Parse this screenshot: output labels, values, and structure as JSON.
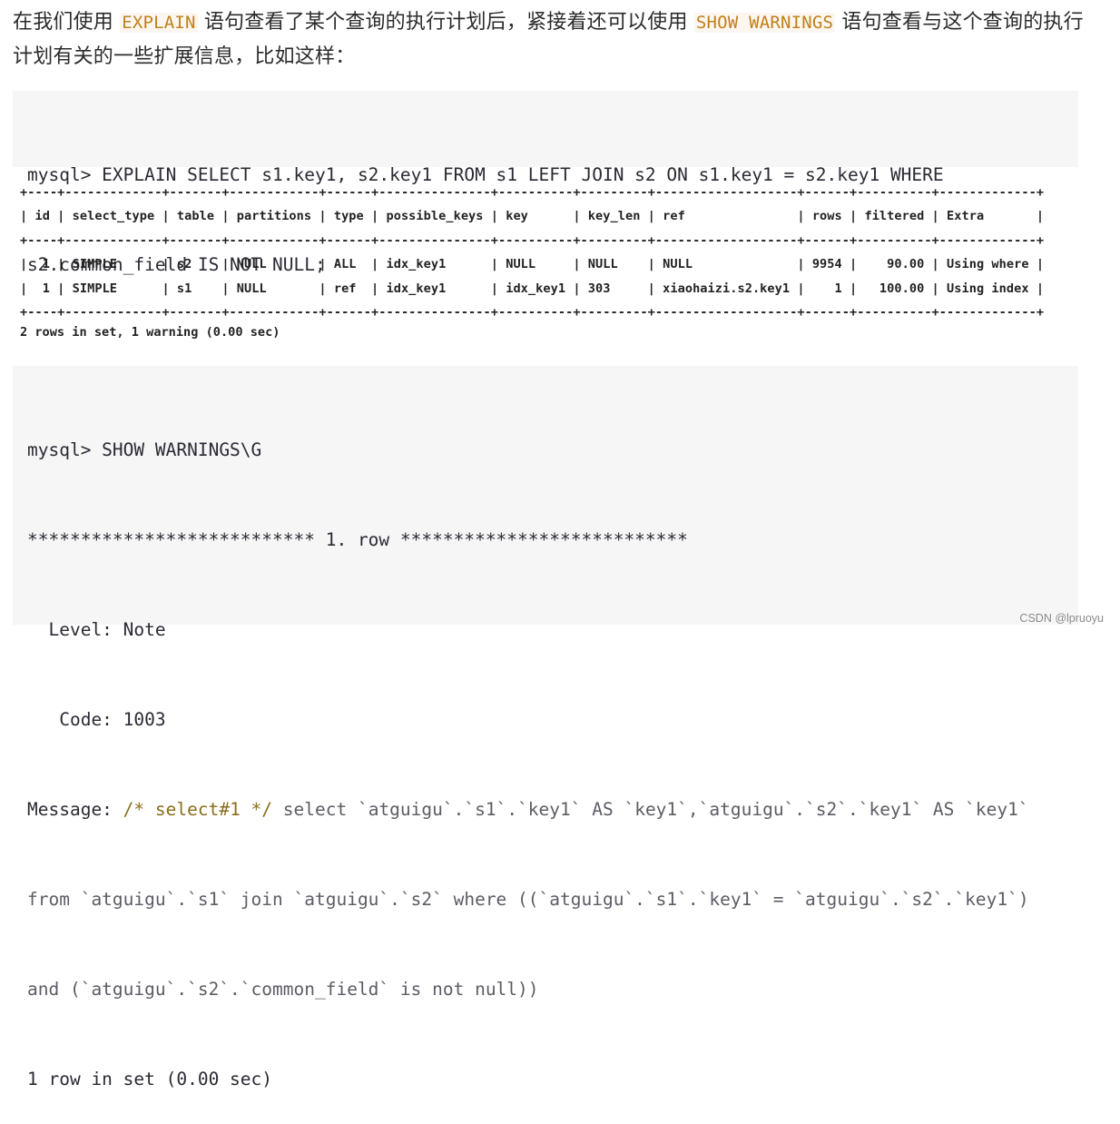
{
  "paragraph": {
    "segments": [
      {
        "type": "text",
        "value": "在我们使用 "
      },
      {
        "type": "code",
        "value": "EXPLAIN"
      },
      {
        "type": "text",
        "value": " 语句查看了某个查询的执行计划后，紧接着还可以使用 "
      },
      {
        "type": "code",
        "value": "SHOW WARNINGS"
      },
      {
        "type": "text",
        "value": " 语句查看与这个查询的执行计划有关的一些扩展信息，比如这样："
      }
    ]
  },
  "code_block_1": {
    "lines": [
      "mysql> EXPLAIN SELECT s1.key1, s2.key1 FROM s1 LEFT JOIN s2 ON s1.key1 = s2.key1 WHERE",
      "s2.common_field IS NOT NULL;"
    ]
  },
  "explain_table": {
    "border": "+----+-------------+-------+------------+------+---------------+----------+---------+-------------------+------+----------+-------------+",
    "columns": [
      "id",
      "select_type",
      "table",
      "partitions",
      "type",
      "possible_keys",
      "key",
      "key_len",
      "ref",
      "rows",
      "filtered",
      "Extra"
    ],
    "rows": [
      [
        "1",
        "SIMPLE",
        "s2",
        "NULL",
        "ALL",
        "idx_key1",
        "NULL",
        "NULL",
        "NULL",
        "9954",
        "90.00",
        "Using where"
      ],
      [
        "1",
        "SIMPLE",
        "s1",
        "NULL",
        "ref",
        "idx_key1",
        "idx_key1",
        "303",
        "xiaohaizi.s2.key1",
        "1",
        "100.00",
        "Using index"
      ]
    ],
    "summary": "2 rows in set, 1 warning (0.00 sec)"
  },
  "code_block_2": {
    "command": "mysql> SHOW WARNINGS\\G",
    "row_header": "*************************** 1. row ***************************",
    "level_label": "  Level:",
    "level_value": " Note",
    "code_label": "   Code:",
    "code_value": " 1003",
    "message_label": "Message: ",
    "message_comment": "/* select#1 */",
    "message_lines": [
      " select `atguigu`.`s1`.`key1` AS `key1`,`atguigu`.`s2`.`key1` AS `key1`",
      "from `atguigu`.`s1` join `atguigu`.`s2` where ((`atguigu`.`s1`.`key1` = `atguigu`.`s2`.`key1`)",
      "and (`atguigu`.`s2`.`common_field` is not null))"
    ],
    "footer": "1 row in set (0.00 sec)"
  },
  "watermark": "CSDN @lpruoyu",
  "colors": {
    "inline_code": "#c1801b",
    "code_bg": "#f6f6f6",
    "comment": "#8a6d1f"
  }
}
